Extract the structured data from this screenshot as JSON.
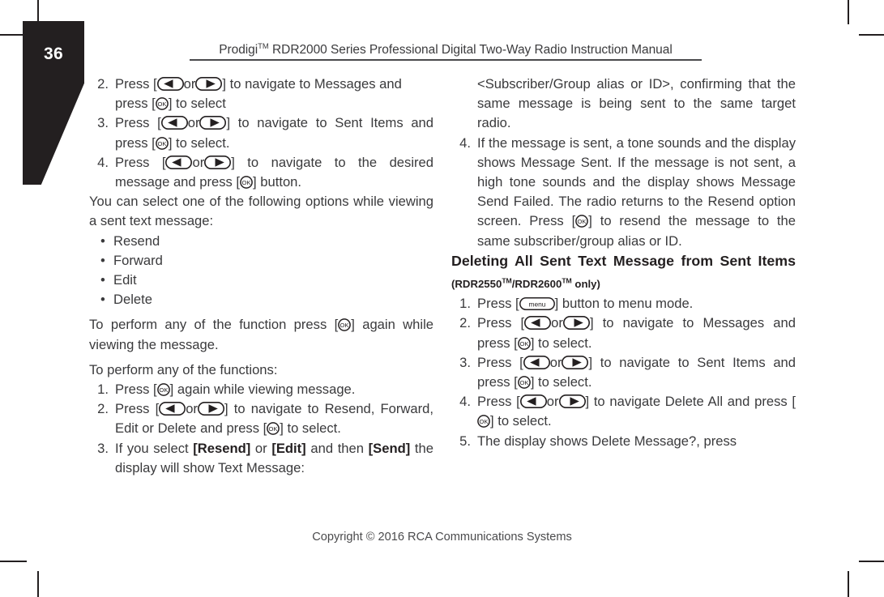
{
  "page": {
    "folio": "36",
    "header_title_pre": "Prodigi",
    "header_title_tm": "TM",
    "header_title_post": " RDR2000 Series Professional Digital Two-Way Radio Instruction Manual",
    "footer": "Copyright © 2016 RCA Communications Systems"
  },
  "icons": {
    "left_arrow": "left-arrow-key-icon",
    "right_arrow": "right-arrow-key-icon",
    "ok": "ok-key-icon",
    "menu": "menu-key-icon",
    "menu_label": "menu",
    "ok_label": "OK"
  },
  "left_column": {
    "steps_top": [
      {
        "num": "2.",
        "parts": [
          "Press [",
          "ARROWS",
          "] to navigate to Messages and press [",
          "OK",
          "] to select"
        ],
        "text_a": "Press [",
        "text_b": "] to navigate to Messages and press [",
        "text_c": "] to select"
      },
      {
        "num": "3.",
        "text_a": "Press [",
        "text_b": "] to navigate to Sent Items and press [",
        "text_c": "] to select."
      },
      {
        "num": "4.",
        "text_a": "Press [",
        "text_b": "] to navigate to the desired message and press [",
        "text_c": "] button."
      }
    ],
    "intro_options": "You can select one of the following options while viewing a sent text message:",
    "options": [
      "Resend",
      "Forward",
      "Edit",
      "Delete"
    ],
    "perform_function_a": "To perform any of the function press [",
    "perform_function_b": "] again while viewing the message.",
    "perform_functions_head": "To perform any of the functions:",
    "steps_bottom": [
      {
        "num": "1.",
        "text_a": "Press [",
        "text_b": "] again while viewing message.",
        "text_c": ""
      },
      {
        "num": "2.",
        "text_a": "Press [",
        "text_b": "] to navigate to Resend, Forward, Edit or Delete and press [",
        "text_c": "] to select."
      },
      {
        "num": "3.",
        "text_a": "If you select ",
        "bold_1": "[Resend]",
        "text_b": " or ",
        "bold_2": "[Edit]",
        "text_c": " and then ",
        "bold_3": "[Send]",
        "text_d": " the display will show Text Message:"
      }
    ]
  },
  "right_column": {
    "continued_paragraph": "<Subscriber/Group alias or ID>, confirming that the same message is being sent to the same target radio.",
    "step_4": {
      "num": "4.",
      "text_a": "If the message is sent, a tone sounds and the display shows Message Sent. If the message is not sent, a high tone sounds and the display shows Message Send Failed. The radio returns to the Resend option screen. Press [",
      "text_b": "] to resend the message to the same subscriber/group alias or ID."
    },
    "section_heading": "Deleting All Sent Text Message from Sent Items ",
    "section_heading_sub_a": "(RDR2550",
    "section_heading_sub_tm1": "TM",
    "section_heading_sub_b": "/RDR2600",
    "section_heading_sub_tm2": "TM",
    "section_heading_sub_c": " only)",
    "steps": [
      {
        "num": "1.",
        "text_a": "Press [",
        "text_b": "] button to menu mode."
      },
      {
        "num": "2.",
        "text_a": "Press [",
        "text_b": "] to navigate to Messages and press [",
        "text_c": "] to select."
      },
      {
        "num": "3.",
        "text_a": "Press [",
        "text_b": "] to navigate to Sent Items and press [",
        "text_c": "] to select."
      },
      {
        "num": "4.",
        "text_a": "Press [",
        "text_b": "] to navigate Delete All and press [",
        "text_c": "] to select."
      },
      {
        "num": "5.",
        "text_a": "The display shows Delete Message?, press",
        "text_b": ""
      }
    ]
  },
  "colors": {
    "ink": "#231f20",
    "body_text": "#3a3a3c",
    "tab_background": "#231f20",
    "folio_text": "#ffffff",
    "page_background": "#ffffff"
  }
}
